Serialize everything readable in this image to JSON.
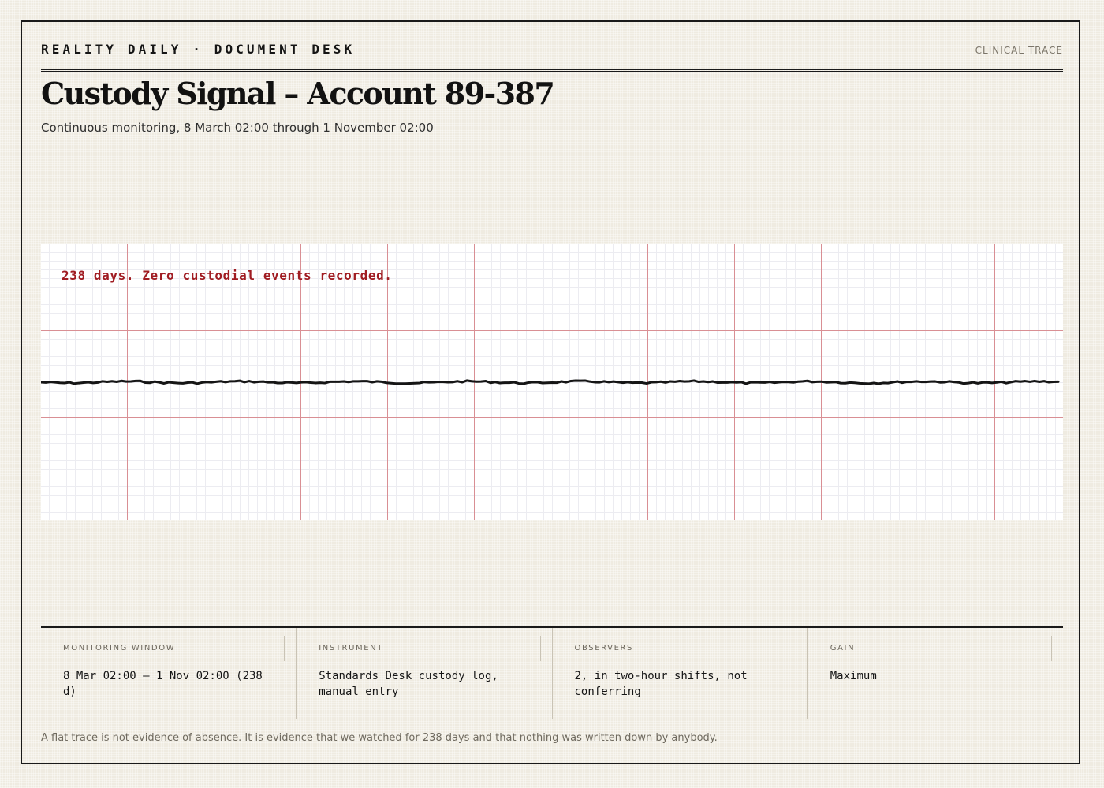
{
  "masthead": {
    "kicker": "REALITY DAILY · DOCUMENT DESK",
    "tag": "CLINICAL TRACE"
  },
  "headline": "Custody Signal – Account 89-387",
  "dek": "Continuous monitoring, 8 March 02:00 through 1 November 02:00",
  "trace": {
    "annotation": "238 days. Zero custodial events recorded.",
    "color": "#151515",
    "annotation_color": "#a01c22",
    "grid_major_color": "#d98f94",
    "grid_minor_color": "#ececf1",
    "signal": "flat"
  },
  "specs": [
    {
      "label": "MONITORING WINDOW",
      "value": "8 Mar 02:00 – 1 Nov 02:00 (238 d)"
    },
    {
      "label": "INSTRUMENT",
      "value": "Standards Desk custody log, manual entry"
    },
    {
      "label": "OBSERVERS",
      "value": "2, in two-hour shifts, not conferring"
    },
    {
      "label": "GAIN",
      "value": "Maximum"
    }
  ],
  "footnote": "A flat trace is not evidence of absence. It is evidence that we watched for 238 days and that nothing was written down by anybody."
}
